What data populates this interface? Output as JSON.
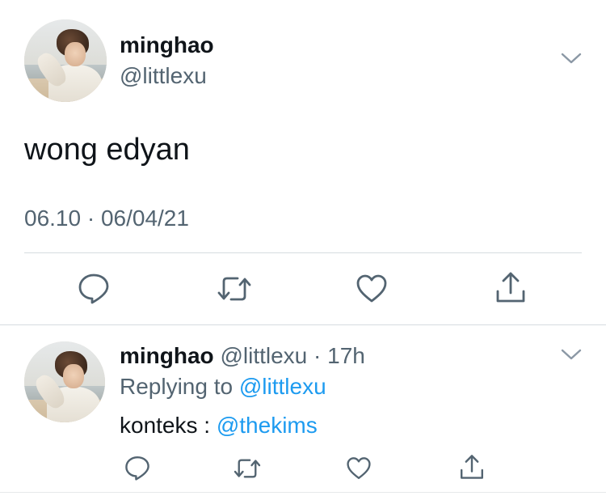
{
  "main_tweet": {
    "display_name": "minghao",
    "handle": "@littlexu",
    "text": "wong edyan",
    "timestamp": "06.10 · 06/04/21",
    "avatar_icon": "profile-photo",
    "more_icon": "chevron-down-icon",
    "actions": [
      "reply-icon",
      "retweet-icon",
      "like-icon",
      "share-icon"
    ]
  },
  "reply_tweet": {
    "display_name": "minghao",
    "handle_time": "@littlexu · 17h",
    "replying_prefix": "Replying to ",
    "replying_to": "@littlexu",
    "text_prefix": "konteks : ",
    "mention": "@thekims",
    "avatar_icon": "profile-photo",
    "more_icon": "chevron-down-icon",
    "actions": [
      "reply-icon",
      "retweet-icon",
      "like-icon",
      "share-icon"
    ]
  },
  "colors": {
    "text_primary": "#0f1419",
    "text_secondary": "#536471",
    "link": "#1d9bf0",
    "icon": "#536471",
    "divider": "#d6dce0"
  }
}
